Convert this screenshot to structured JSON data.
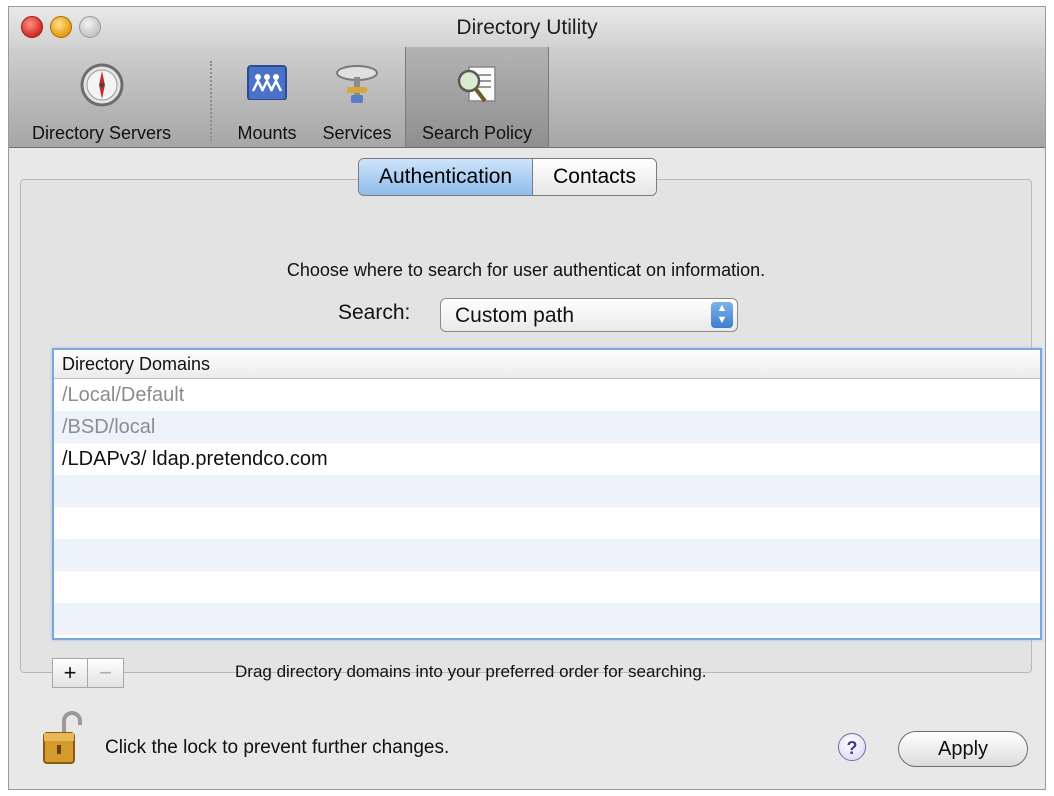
{
  "window": {
    "title": "Directory Utility"
  },
  "toolbar": {
    "items": [
      {
        "label": "Directory Servers",
        "icon": "compass-icon"
      },
      {
        "label": "Mounts",
        "icon": "network-users-icon"
      },
      {
        "label": "Services",
        "icon": "services-icon"
      },
      {
        "label": "Search Policy",
        "icon": "search-policy-icon",
        "selected": true
      }
    ]
  },
  "tabs": [
    {
      "label": "Authentication",
      "selected": true
    },
    {
      "label": "Contacts",
      "selected": false
    }
  ],
  "instruction": "Choose where to search for user authenticat on information.",
  "search": {
    "label": "Search:",
    "value": "Custom path"
  },
  "table": {
    "header": "Directory Domains",
    "rows": [
      {
        "label": "/Local/Default",
        "dimmed": true
      },
      {
        "label": "/BSD/local",
        "dimmed": true
      },
      {
        "label": "/LDAPv3/ ldap.pretendco.com",
        "dimmed": false
      }
    ]
  },
  "controls": {
    "plus_label": "+",
    "minus_label": "−"
  },
  "hint": "Drag directory domains into your preferred order for searching.",
  "lock": {
    "text": "Click the lock to prevent further changes.",
    "icon": "unlocked-padlock-icon"
  },
  "help": {
    "label": "?"
  },
  "apply": {
    "label": "Apply"
  }
}
